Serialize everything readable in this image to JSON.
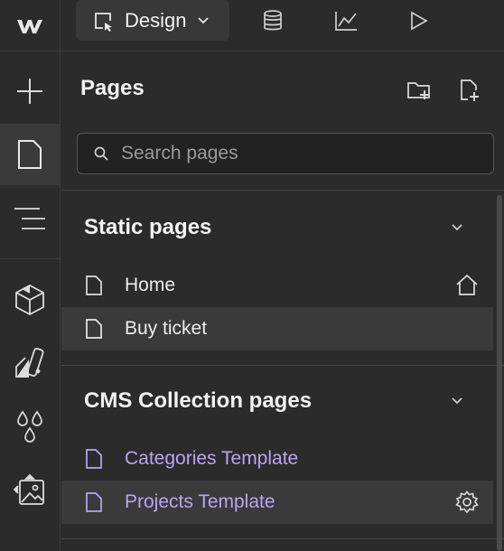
{
  "topbar": {
    "logo_icon": "webflow-logo-icon",
    "mode_label": "Design",
    "icons": [
      "cms-database-icon",
      "analytics-chart-icon",
      "play-preview-icon"
    ]
  },
  "rail": {
    "items": [
      "add-icon",
      "pages-icon",
      "navigator-icon",
      "components-icon",
      "styles-icon",
      "variables-icon",
      "assets-icon"
    ],
    "active": "pages-icon"
  },
  "panel": {
    "title": "Pages",
    "search_placeholder": "Search pages",
    "sections": [
      {
        "title": "Static pages",
        "items": [
          {
            "label": "Home",
            "trailing_icon": "home-icon"
          },
          {
            "label": "Buy ticket",
            "selected": true
          }
        ]
      },
      {
        "title": "CMS Collection pages",
        "items": [
          {
            "label": "Categories Template"
          },
          {
            "label": "Projects Template",
            "trailing_icon": "settings-gear-icon"
          }
        ]
      }
    ]
  },
  "colors": {
    "background": "#2b2b2b",
    "selected_row": "#3a3a3a",
    "cms_text": "#b9a4f5"
  }
}
